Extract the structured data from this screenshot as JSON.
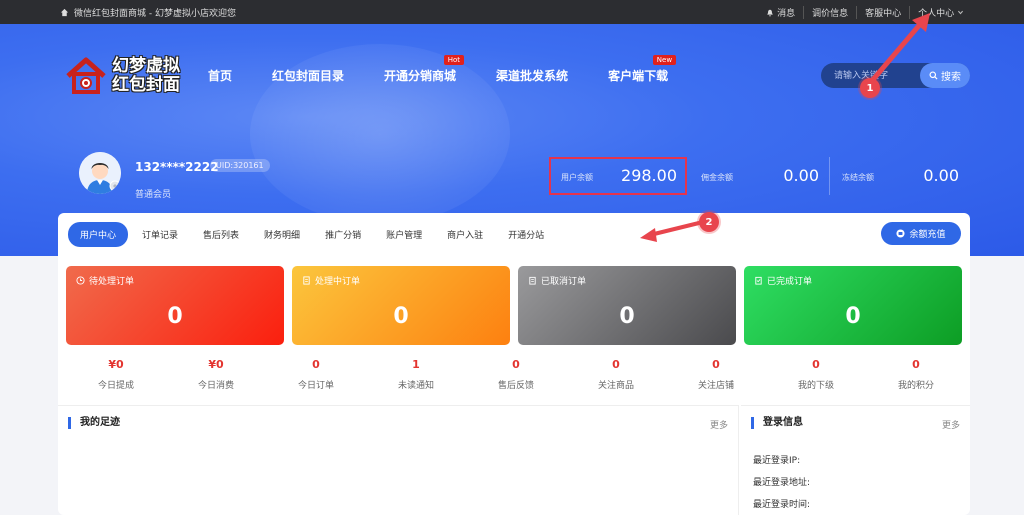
{
  "topbar": {
    "site_name": "微信红包封面商城 - 幻梦虚拟小店欢迎您",
    "links": [
      "消息",
      "调价信息",
      "客服中心",
      "个人中心"
    ]
  },
  "logo": {
    "line1": "幻梦虚拟",
    "line2": "红包封面"
  },
  "nav": [
    {
      "label": "首页",
      "badge": ""
    },
    {
      "label": "红包封面目录",
      "badge": ""
    },
    {
      "label": "开通分销商城",
      "badge": "Hot"
    },
    {
      "label": "渠道批发系统",
      "badge": ""
    },
    {
      "label": "客户端下载",
      "badge": "New"
    }
  ],
  "search": {
    "placeholder": "请输入关键字",
    "button": "搜索"
  },
  "user": {
    "name": "132****2222",
    "uid": "UID:320161",
    "level": "普通会员"
  },
  "balances": [
    {
      "label": "用户余额",
      "value": "298.00"
    },
    {
      "label": "佣金余额",
      "value": "0.00"
    },
    {
      "label": "冻结余额",
      "value": "0.00"
    }
  ],
  "tabs": [
    "用户中心",
    "订单记录",
    "售后列表",
    "财务明细",
    "推广分销",
    "账户管理",
    "商户入驻",
    "开通分站"
  ],
  "recharge_label": "余额充值",
  "order_stats": [
    {
      "label": "待处理订单",
      "value": "0"
    },
    {
      "label": "处理中订单",
      "value": "0"
    },
    {
      "label": "已取消订单",
      "value": "0"
    },
    {
      "label": "已完成订单",
      "value": "0"
    }
  ],
  "metrics": [
    {
      "value": "¥0",
      "label": "今日提成"
    },
    {
      "value": "¥0",
      "label": "今日消费"
    },
    {
      "value": "0",
      "label": "今日订单"
    },
    {
      "value": "1",
      "label": "未读通知"
    },
    {
      "value": "0",
      "label": "售后反馈"
    },
    {
      "value": "0",
      "label": "关注商品"
    },
    {
      "value": "0",
      "label": "关注店铺"
    },
    {
      "value": "0",
      "label": "我的下级"
    },
    {
      "value": "0",
      "label": "我的积分"
    }
  ],
  "footprint": {
    "title": "我的足迹",
    "more": "更多"
  },
  "login_info": {
    "title": "登录信息",
    "more": "更多",
    "rows": [
      "最近登录IP:",
      "最近登录地址:",
      "最近登录时间:"
    ]
  },
  "annotations": [
    "1",
    "2"
  ],
  "colors": {
    "primary": "#2f68e6",
    "accent_red": "#e8454d"
  }
}
